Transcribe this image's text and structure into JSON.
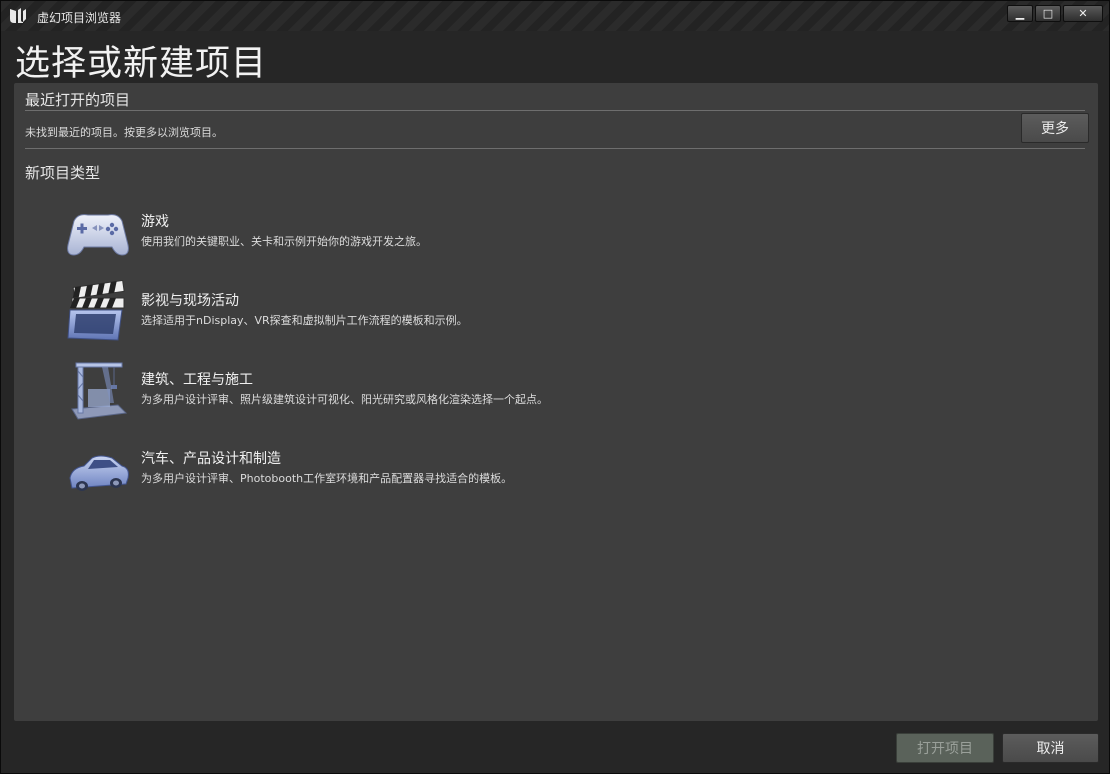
{
  "window": {
    "title": "虚幻项目浏览器",
    "minimize_glyph": "▁",
    "maximize_glyph": "□",
    "close_glyph": "✕"
  },
  "page": {
    "headline": "选择或新建项目"
  },
  "recent": {
    "title": "最近打开的项目",
    "empty_message": "未找到最近的项目。按更多以浏览项目。",
    "more_label": "更多"
  },
  "new_project": {
    "title": "新项目类型",
    "categories": [
      {
        "name": "游戏",
        "description": "使用我们的关键职业、关卡和示例开始你的游戏开发之旅。",
        "icon": "gamepad-icon"
      },
      {
        "name": "影视与现场活动",
        "description": "选择适用于nDisplay、VR探查和虚拟制片工作流程的模板和示例。",
        "icon": "clapperboard-icon"
      },
      {
        "name": "建筑、工程与施工",
        "description": "为多用户设计评审、照片级建筑设计可视化、阳光研究或风格化渲染选择一个起点。",
        "icon": "crane-icon"
      },
      {
        "name": "汽车、产品设计和制造",
        "description": "为多用户设计评审、Photobooth工作室环境和产品配置器寻找适合的模板。",
        "icon": "car-icon"
      }
    ]
  },
  "footer": {
    "open_label": "打开项目",
    "cancel_label": "取消"
  },
  "colors": {
    "panel": "#3e3e3e",
    "icon_blue": "#8fa6d8",
    "disabled_button": "#5a625a"
  }
}
